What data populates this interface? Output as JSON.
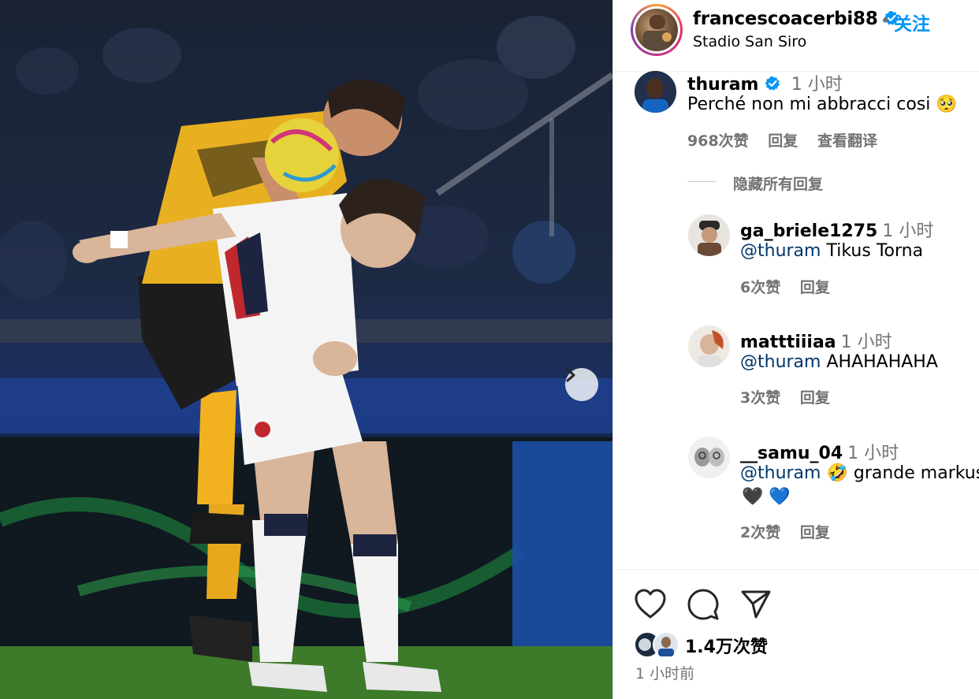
{
  "post": {
    "author": "francescoacerbi88",
    "follow_label": "关注",
    "separator": "•",
    "location": "Stadio San Siro",
    "likes": "1.4万次赞",
    "posted_ago": "1 小时前"
  },
  "comments": [
    {
      "username": "thuram",
      "verified": true,
      "time": "1 小时",
      "text": "Perché non mi abbracci cosi",
      "emoji": "🥺",
      "likes": "968次赞",
      "reply_label": "回复",
      "translate_label": "查看翻译"
    }
  ],
  "hide_replies_label": "隐藏所有回复",
  "replies": [
    {
      "username": "ga_briele1275",
      "time": "1 小时",
      "mention": "@thuram",
      "text": " Tikus Torna",
      "likes": "6次赞",
      "reply_label": "回复"
    },
    {
      "username": "matttiiiaa",
      "time": "1 小时",
      "mention": "@thuram",
      "text": " AHAHAHAHA",
      "likes": "3次赞",
      "reply_label": "回复"
    },
    {
      "username": "__samu_04",
      "time": "1 小时",
      "mention": "@thuram",
      "text": " 🤣 grande markus",
      "text_line2": "🖤 💙",
      "likes": "2次赞",
      "reply_label": "回复"
    }
  ],
  "icons": {
    "like": "heart-icon",
    "comment": "comment-icon",
    "share": "send-icon",
    "next": "chevron-right-icon",
    "verified": "verified-badge-icon"
  },
  "colors": {
    "accent": "#0095f6",
    "mention": "#00376b",
    "muted": "#737373",
    "verified": "#0095f6"
  }
}
